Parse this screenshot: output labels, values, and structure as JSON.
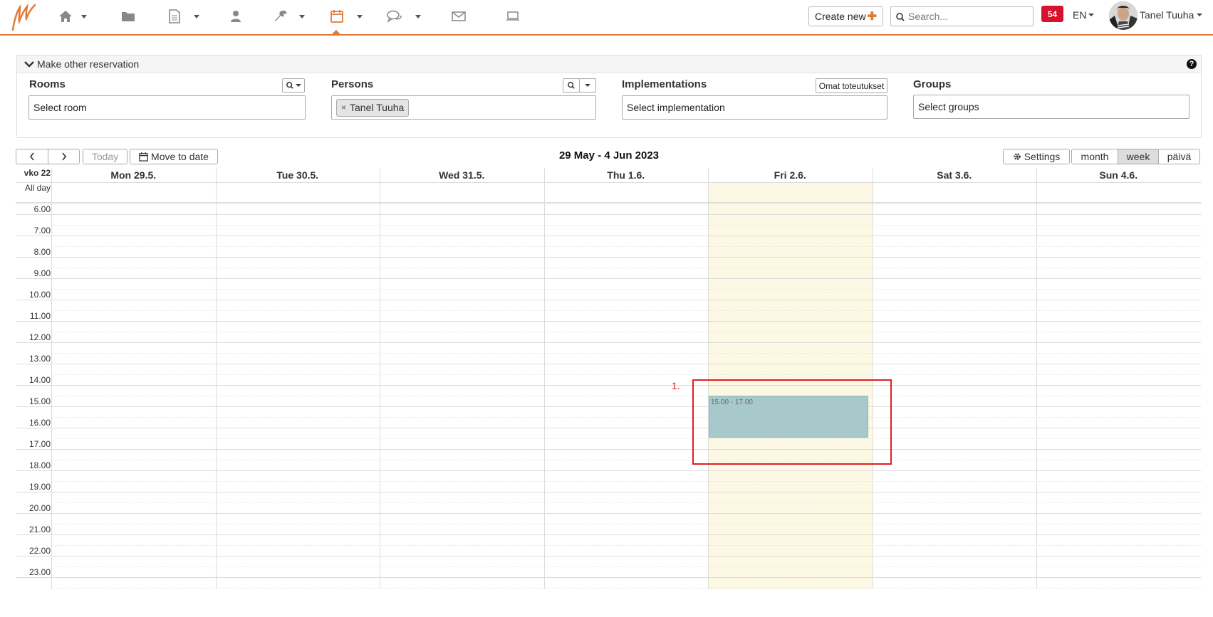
{
  "navbar": {
    "active_section": "calendar",
    "items": [
      {
        "icon": "home-icon",
        "has_menu": true
      },
      {
        "icon": "folder-icon",
        "has_menu": false
      },
      {
        "icon": "document-icon",
        "has_menu": true
      },
      {
        "icon": "user-icon",
        "has_menu": false
      },
      {
        "icon": "wrench-icon",
        "has_menu": true
      },
      {
        "icon": "calendar-icon",
        "has_menu": true
      },
      {
        "icon": "chat-icon",
        "has_menu": true
      },
      {
        "icon": "mail-icon",
        "has_menu": false
      },
      {
        "icon": "laptop-icon",
        "has_menu": false
      }
    ],
    "create_label": "Create new",
    "search_placeholder": "Search...",
    "notifications_count": "54",
    "language": "EN",
    "user_name": "Tanel Tuuha"
  },
  "reservation_panel": {
    "title": "Make other reservation",
    "rooms": {
      "label": "Rooms",
      "placeholder": "Select room"
    },
    "persons": {
      "label": "Persons",
      "selected_tag": "Tanel Tuuha"
    },
    "implementations": {
      "label": "Implementations",
      "button": "Omat toteutukset",
      "placeholder": "Select implementation"
    },
    "groups": {
      "label": "Groups",
      "placeholder": "Select groups"
    }
  },
  "calendar": {
    "toolbar": {
      "today": "Today",
      "move_to_date": "Move to date",
      "title": "29 May - 4 Jun 2023",
      "settings": "Settings",
      "views": [
        "month",
        "week",
        "päivä"
      ],
      "active_view": "week"
    },
    "week_label": "vko 22",
    "all_day_label": "All day",
    "days": [
      "Mon 29.5.",
      "Tue 30.5.",
      "Wed 31.5.",
      "Thu 1.6.",
      "Fri 2.6.",
      "Sat 3.6.",
      "Sun 4.6."
    ],
    "today": "Fri 2.6.",
    "hours": [
      "6.00",
      "7.00",
      "8.00",
      "9.00",
      "10.00",
      "11.00",
      "12.00",
      "13.00",
      "14.00",
      "15.00",
      "16.00",
      "17.00",
      "18.00",
      "19.00",
      "20.00",
      "21.00",
      "22.00",
      "23.00"
    ],
    "events": [
      {
        "day": "Fri 2.6.",
        "time": "15.00 - 17.00"
      }
    ]
  },
  "annotation": {
    "label": "1.",
    "color": "#e21e26"
  },
  "colors": {
    "accent": "#e07b39",
    "badge": "#d9112e",
    "today_bg": "#fcf8e3",
    "event_bg": "#a8c9cc"
  }
}
